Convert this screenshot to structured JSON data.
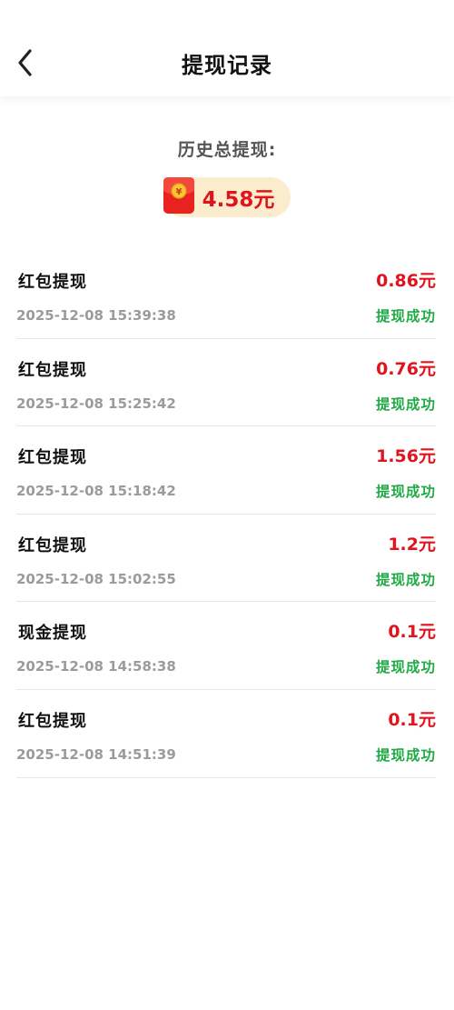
{
  "header": {
    "title": "提现记录",
    "back_icon": "chevron-left-icon"
  },
  "summary": {
    "label": "历史总提现:",
    "amount": "4.58元",
    "icon": "red-packet-icon"
  },
  "colors": {
    "amount": "#e0141c",
    "status_success": "#1faa44",
    "pill_bg": "#fbeccd"
  },
  "records": [
    {
      "title": "红包提现",
      "time": "2025-12-08 15:39:38",
      "amount": "0.86元",
      "status": "提现成功"
    },
    {
      "title": "红包提现",
      "time": "2025-12-08 15:25:42",
      "amount": "0.76元",
      "status": "提现成功"
    },
    {
      "title": "红包提现",
      "time": "2025-12-08 15:18:42",
      "amount": "1.56元",
      "status": "提现成功"
    },
    {
      "title": "红包提现",
      "time": "2025-12-08 15:02:55",
      "amount": "1.2元",
      "status": "提现成功"
    },
    {
      "title": "现金提现",
      "time": "2025-12-08 14:58:38",
      "amount": "0.1元",
      "status": "提现成功"
    },
    {
      "title": "红包提现",
      "time": "2025-12-08 14:51:39",
      "amount": "0.1元",
      "status": "提现成功"
    }
  ]
}
